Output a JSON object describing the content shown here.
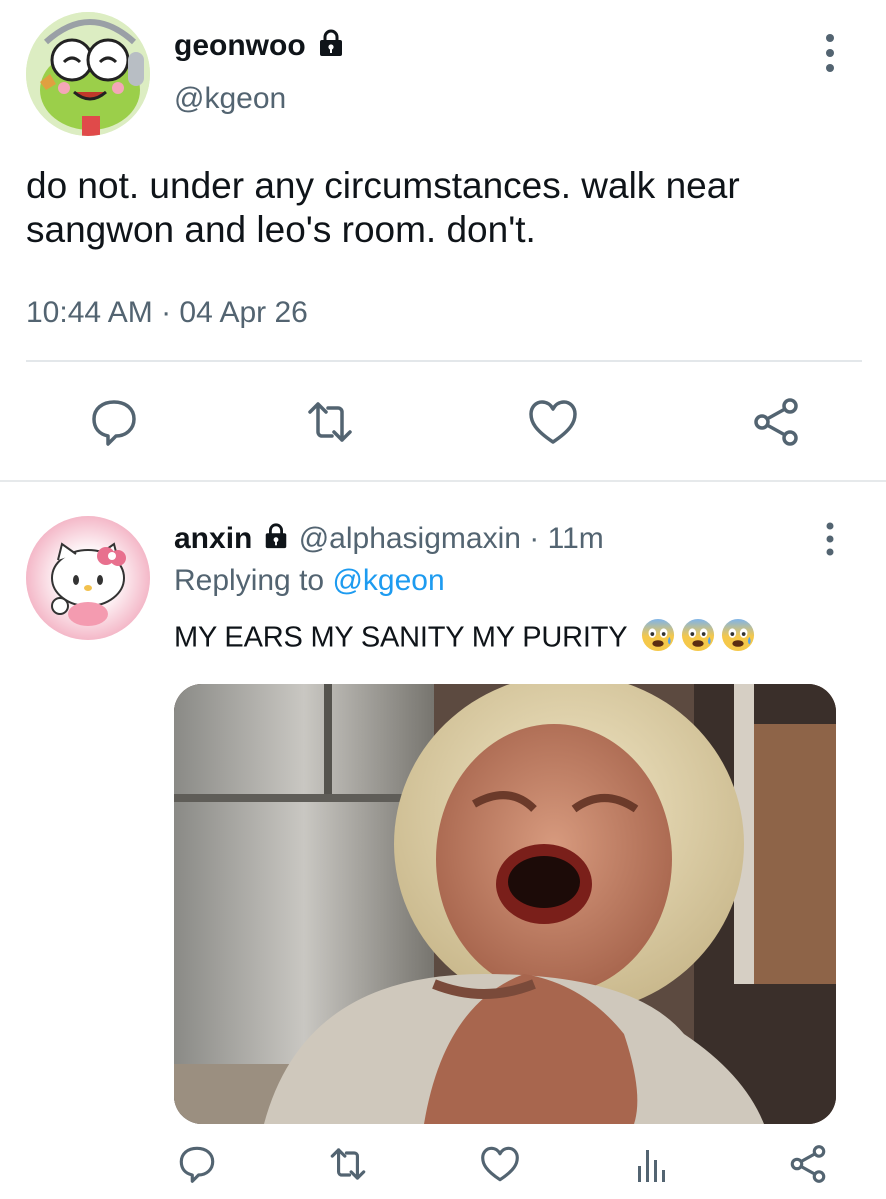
{
  "tweet": {
    "display_name": "geonwoo",
    "handle": "@kgeon",
    "text": "do not. under any circumstances. walk near sangwon and leo's room. don't.",
    "timestamp": "10:44 AM · 04 Apr 26",
    "actions": [
      "reply-icon",
      "retweet-icon",
      "like-icon",
      "share-icon"
    ]
  },
  "reply": {
    "display_name": "anxin",
    "handle": "@alphasigmaxin",
    "separator": "·",
    "age": "11m",
    "replying_prefix": "Replying to",
    "replying_to": "@kgeon",
    "text": "MY EARS MY SANITY MY PURITY",
    "emoji": [
      "fearful-face-emoji",
      "fearful-face-emoji",
      "fearful-face-emoji"
    ],
    "media": "photo of a crying woman with blonde hair in a kitchen",
    "actions": [
      "reply-icon",
      "retweet-icon",
      "like-icon",
      "analytics-icon",
      "share-icon"
    ]
  },
  "colors": {
    "text": "#0f1419",
    "secondary": "#536471",
    "link": "#1d9bf0",
    "divider": "#e3e7ea"
  }
}
